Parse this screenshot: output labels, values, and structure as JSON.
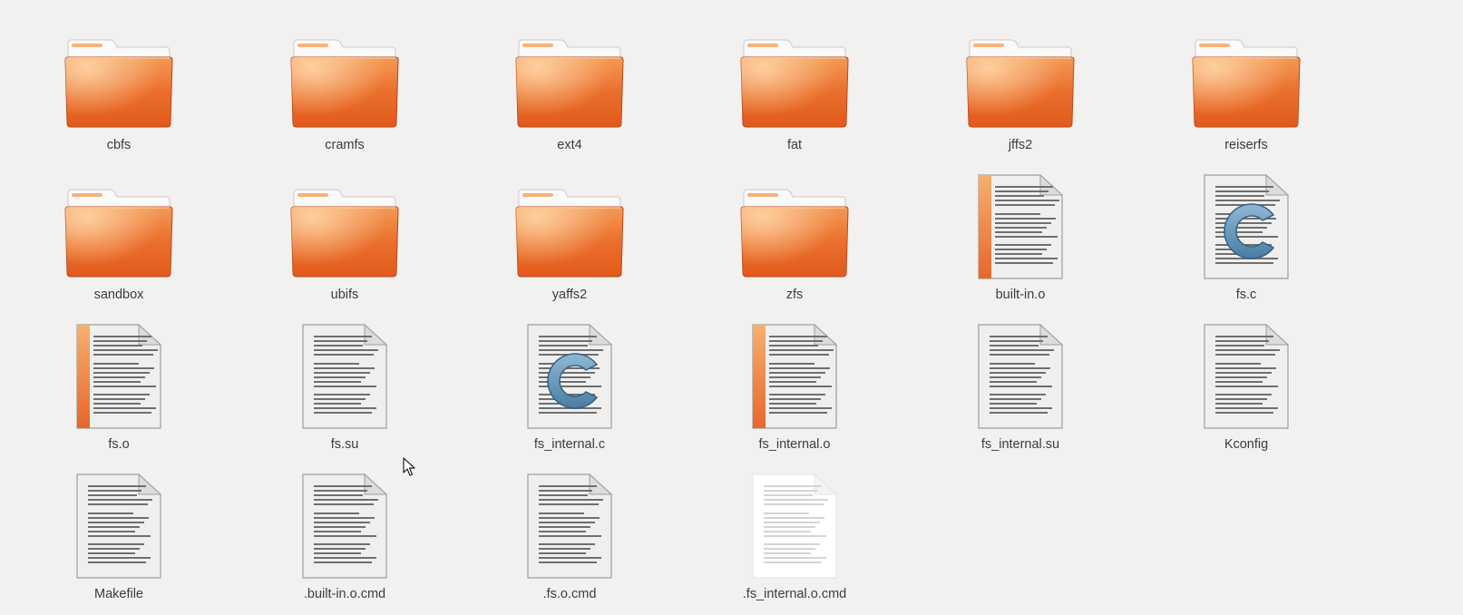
{
  "file_manager": {
    "items": [
      {
        "name": "cbfs",
        "kind": "folder"
      },
      {
        "name": "cramfs",
        "kind": "folder"
      },
      {
        "name": "ext4",
        "kind": "folder"
      },
      {
        "name": "fat",
        "kind": "folder"
      },
      {
        "name": "jffs2",
        "kind": "folder"
      },
      {
        "name": "reiserfs",
        "kind": "folder"
      },
      {
        "name": "sandbox",
        "kind": "folder"
      },
      {
        "name": "ubifs",
        "kind": "folder"
      },
      {
        "name": "yaffs2",
        "kind": "folder"
      },
      {
        "name": "zfs",
        "kind": "folder"
      },
      {
        "name": "built-in.o",
        "kind": "object"
      },
      {
        "name": "fs.c",
        "kind": "c-source"
      },
      {
        "name": "fs.o",
        "kind": "object"
      },
      {
        "name": "fs.su",
        "kind": "text"
      },
      {
        "name": "fs_internal.c",
        "kind": "c-source"
      },
      {
        "name": "fs_internal.o",
        "kind": "object"
      },
      {
        "name": "fs_internal.su",
        "kind": "text"
      },
      {
        "name": "Kconfig",
        "kind": "text"
      },
      {
        "name": "Makefile",
        "kind": "text"
      },
      {
        "name": ".built-in.o.cmd",
        "kind": "text"
      },
      {
        "name": ".fs.o.cmd",
        "kind": "text"
      },
      {
        "name": ".fs_internal.o.cmd",
        "kind": "text-faded"
      }
    ]
  },
  "colors": {
    "folder_front": "#e25a1c",
    "folder_top": "#f6b27a",
    "object_stripe": "#e8662a",
    "c_logo": "#4a7da3",
    "background": "#f2f1f0"
  },
  "icons": {
    "folder": "folder-icon",
    "object": "object-file-icon",
    "c-source": "c-source-file-icon",
    "text": "text-file-icon",
    "text-faded": "text-file-icon",
    "cursor": "mouse-pointer-icon"
  }
}
